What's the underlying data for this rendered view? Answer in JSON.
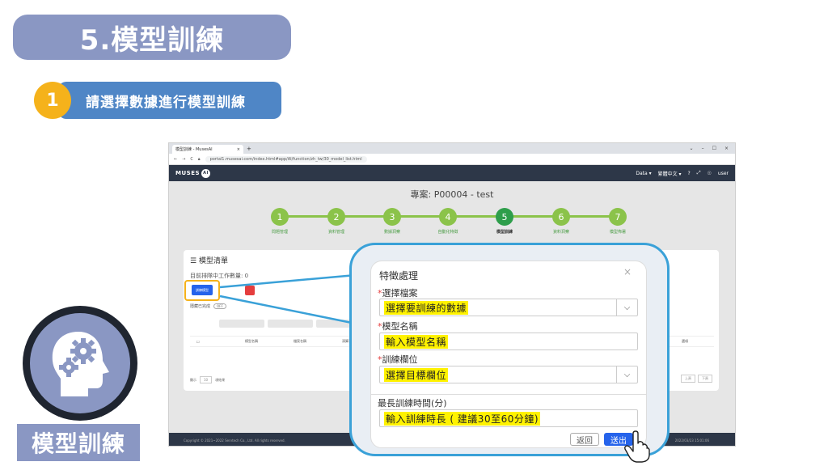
{
  "slide": {
    "title": "5.模型訓練",
    "step_number": "1",
    "step_text": "請選擇數據進行模型訓練",
    "bottom_label": "模型訓練"
  },
  "browser": {
    "tab_title": "模型訓練 - MusesAI",
    "tab_close": "×",
    "new_tab": "+",
    "url": "portal1.musesai.com/index.html#app/AI/function/zh_tw/30_model_list.html",
    "window_controls": [
      "⌄",
      "–",
      "☐",
      "×"
    ]
  },
  "app": {
    "logo_text": "MUSES",
    "logo_badge": "AI",
    "header_items": [
      "Data ▾",
      "繁體中文 ▾",
      "?",
      "⤢",
      "☉",
      "user"
    ],
    "project_title": "專案: P00004 - test",
    "steps": [
      {
        "num": "1",
        "label": "問題管理"
      },
      {
        "num": "2",
        "label": "資料管理"
      },
      {
        "num": "3",
        "label": "數據洞察"
      },
      {
        "num": "4",
        "label": "自動化特徵"
      },
      {
        "num": "5",
        "label": "模型訓練"
      },
      {
        "num": "6",
        "label": "資料洞察"
      },
      {
        "num": "7",
        "label": "模型佈署"
      }
    ],
    "list_title": "模型清單",
    "job_count": "目前排隊中工作數量: 0",
    "train_button": "訓練模型",
    "hide_completed": "隱藏已完成",
    "toggle": "OFF",
    "table_headers": [
      "模型名稱",
      "檔案名稱",
      "演算法",
      "指標"
    ],
    "table_header_right": "選項",
    "pager_label": "顯示",
    "pager_value": "10",
    "pager_suffix": "項結果",
    "pager_prev": "上頁",
    "pager_next": "下頁",
    "footer_left": "Copyright © 2021~2022 Servtech Co., Ltd. All rights reserved.",
    "footer_right": "2022/03/23 15:01:06"
  },
  "dialog": {
    "title": "特徵處理",
    "close": "×",
    "file_label": "選擇檔案",
    "file_value": "選擇要訓練的數據",
    "name_label": "模型名稱",
    "name_value": "輸入模型名稱",
    "target_label": "訓練欄位",
    "target_value": "選擇目標欄位",
    "time_label": "最長訓練時間(分)",
    "time_value": "輸入訓練時長 ( 建議30至60分鐘)",
    "back_button": "返回",
    "send_button": "送出",
    "required_mark": "*",
    "select_arrow": "⌵"
  },
  "colors": {
    "slide_accent": "#8a97c3",
    "step_bar": "#4f86c6",
    "step_badge": "#f5b21b",
    "stepper_green": "#8bc34a",
    "callout_border": "#3aa1d8",
    "highlight": "#fff200"
  },
  "icons": [
    "head-gears-icon",
    "list-icon",
    "chevron-down-icon",
    "close-icon",
    "pointer-hand-icon"
  ]
}
